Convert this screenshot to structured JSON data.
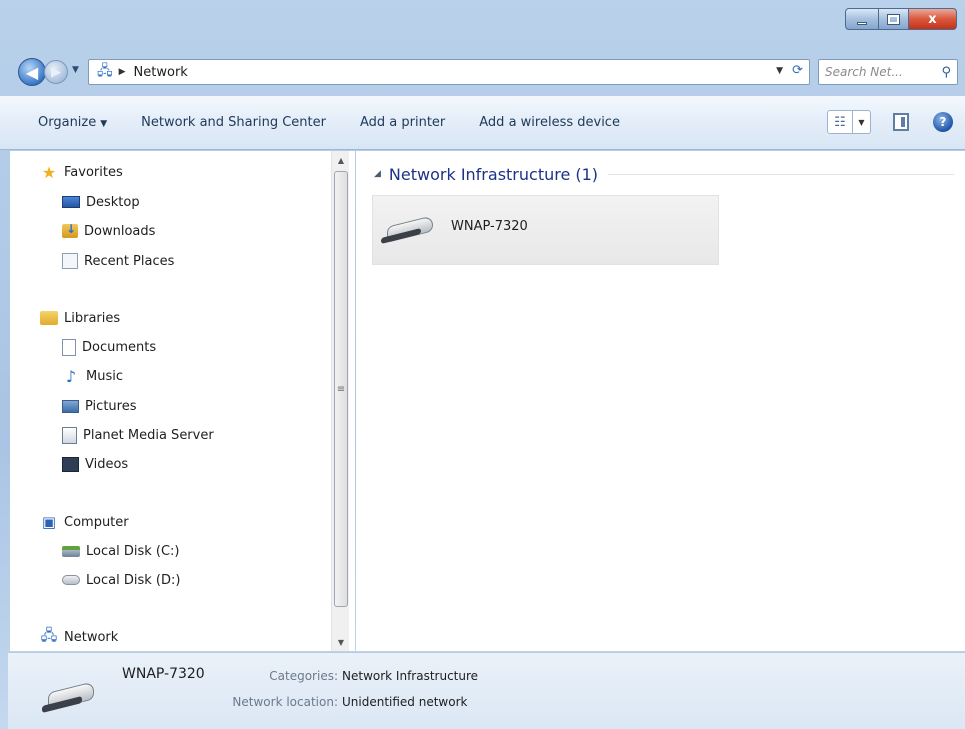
{
  "window": {
    "caption_buttons": {
      "minimize": "minimize",
      "maximize": "maximize",
      "close": "x"
    }
  },
  "nav": {
    "address": "Network",
    "search_placeholder": "Search Net..."
  },
  "toolbar": {
    "organize": "Organize",
    "network_sharing": "Network and Sharing Center",
    "add_printer": "Add a printer",
    "add_wireless": "Add a wireless device"
  },
  "sidebar": {
    "favorites": "Favorites",
    "desktop": "Desktop",
    "downloads": "Downloads",
    "recent_places": "Recent Places",
    "libraries": "Libraries",
    "documents": "Documents",
    "music": "Music",
    "pictures": "Pictures",
    "planet_media_server": "Planet Media Server",
    "videos": "Videos",
    "computer": "Computer",
    "local_disk_c": "Local Disk (C:)",
    "local_disk_d": "Local Disk (D:)",
    "network": "Network"
  },
  "content": {
    "group_title": "Network Infrastructure (1)",
    "items": [
      {
        "label": "WNAP-7320"
      }
    ]
  },
  "details": {
    "name": "WNAP-7320",
    "categories_key": "Categories:",
    "categories_val": "Network Infrastructure",
    "location_key": "Network location:",
    "location_val": "Unidentified network"
  },
  "colors": {
    "chrome": "#b9d1ea",
    "toolbar_text": "#1e395b",
    "group_title": "#1e3287",
    "close_button": "#d9583d"
  }
}
